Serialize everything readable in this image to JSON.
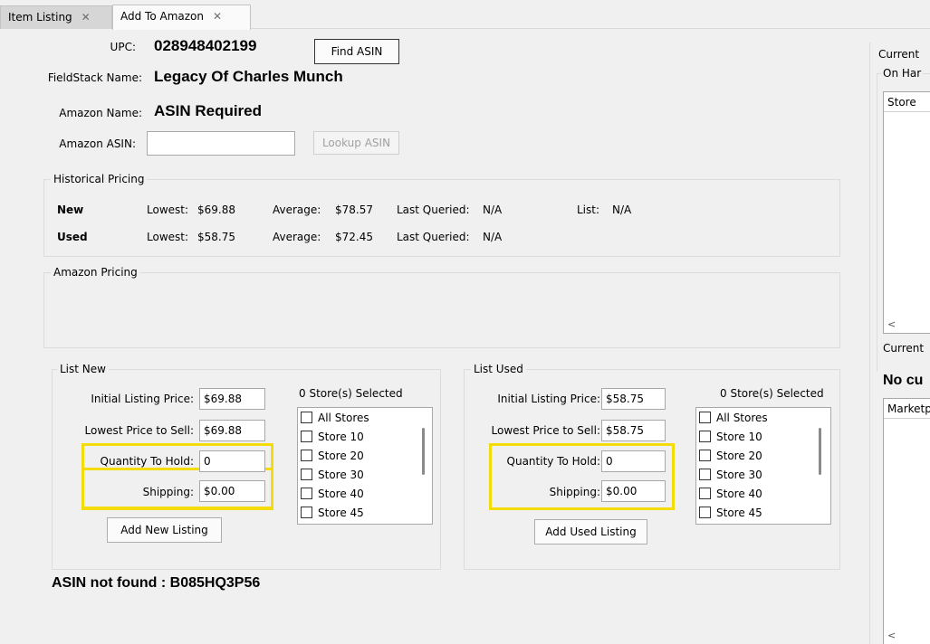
{
  "tabs": [
    {
      "label": "Item Listing",
      "close": "✕"
    },
    {
      "label": "Add To Amazon",
      "close": "✕"
    }
  ],
  "header": {
    "upc_label": "UPC:",
    "upc_value": "028948402199",
    "find_asin_label": "Find ASIN",
    "fieldstack_name_label": "FieldStack Name:",
    "fieldstack_name_value": "Legacy Of Charles Munch",
    "amazon_name_label": "Amazon Name:",
    "amazon_name_value": "ASIN Required",
    "amazon_asin_label": "Amazon ASIN:",
    "amazon_asin_value": "",
    "lookup_asin_label": "Lookup ASIN"
  },
  "historical_pricing": {
    "title": "Historical Pricing",
    "rows": [
      {
        "condition": "New",
        "lowest_label": "Lowest:",
        "lowest": "$69.88",
        "average_label": "Average:",
        "average": "$78.57",
        "last_queried_label": "Last Queried:",
        "last_queried": "N/A",
        "list_label": "List:",
        "list": "N/A"
      },
      {
        "condition": "Used",
        "lowest_label": "Lowest:",
        "lowest": "$58.75",
        "average_label": "Average:",
        "average": "$72.45",
        "last_queried_label": "Last Queried:",
        "last_queried": "N/A"
      }
    ]
  },
  "amazon_pricing": {
    "title": "Amazon Pricing"
  },
  "list_new": {
    "title": "List New",
    "initial_price_label": "Initial Listing Price:",
    "initial_price": "$69.88",
    "lowest_price_label": "Lowest Price to Sell:",
    "lowest_price": "$69.88",
    "quantity_label": "Quantity To Hold:",
    "quantity": "0",
    "shipping_label": "Shipping:",
    "shipping": "$0.00",
    "stores_selected": "0 Store(s) Selected",
    "stores": [
      "All Stores",
      "Store 10",
      "Store 20",
      "Store 30",
      "Store 40",
      "Store 45"
    ],
    "add_button": "Add New Listing"
  },
  "list_used": {
    "title": "List Used",
    "initial_price_label": "Initial Listing Price:",
    "initial_price": "$58.75",
    "lowest_price_label": "Lowest Price to Sell:",
    "lowest_price": "$58.75",
    "quantity_label": "Quantity To Hold:",
    "quantity": "0",
    "shipping_label": "Shipping:",
    "shipping": "$0.00",
    "stores_selected": "0 Store(s) Selected",
    "stores": [
      "All Stores",
      "Store 10",
      "Store 20",
      "Store 30",
      "Store 40",
      "Store 45"
    ],
    "add_button": "Add Used Listing"
  },
  "status_message": "ASIN not found : B085HQ3P56",
  "right_panel": {
    "tab_label": "Current",
    "on_hand_title": "On Har",
    "store_column": "Store",
    "current_title": "Current",
    "no_current_text": "No cu",
    "marketplace_column": "Marketp",
    "scroll_left": "<"
  },
  "colors": {
    "highlight": "#f3dc0a",
    "background": "#f0f0f0"
  }
}
